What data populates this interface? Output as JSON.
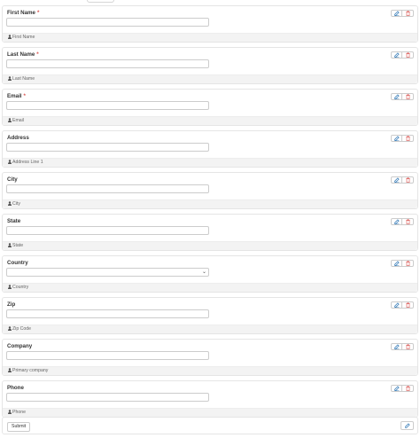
{
  "form": {
    "fields": [
      {
        "label": "First Name",
        "required": true,
        "type": "text",
        "help": "First Name"
      },
      {
        "label": "Last Name",
        "required": true,
        "type": "text",
        "help": "Last Name"
      },
      {
        "label": "Email",
        "required": true,
        "type": "text",
        "help": "Email"
      },
      {
        "label": "Address",
        "required": false,
        "type": "text",
        "help": "Address Line 1"
      },
      {
        "label": "City",
        "required": false,
        "type": "text",
        "help": "City"
      },
      {
        "label": "State",
        "required": false,
        "type": "text",
        "help": "State"
      },
      {
        "label": "Country",
        "required": false,
        "type": "select",
        "help": "Country"
      },
      {
        "label": "Zip",
        "required": false,
        "type": "text",
        "help": "Zip Code"
      },
      {
        "label": "Company",
        "required": false,
        "type": "text",
        "help": "Primary company"
      },
      {
        "label": "Phone",
        "required": false,
        "type": "text",
        "help": "Phone"
      }
    ],
    "required_mark": "*",
    "submit_label": "Submit"
  },
  "icons": {
    "edit": "edit-icon",
    "delete": "trash-icon",
    "help": "user-icon",
    "select": "chevron-down-icon"
  },
  "colors": {
    "required": "#d9534f",
    "edit_icon": "#337ab7",
    "delete_icon": "#d9534f"
  }
}
